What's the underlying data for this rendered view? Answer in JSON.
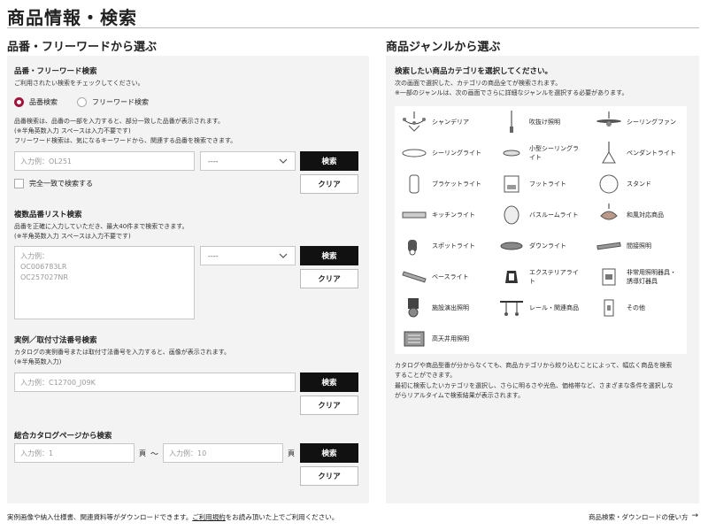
{
  "page": {
    "title": "商品情報・検索"
  },
  "left": {
    "heading": "品番・フリーワードから選ぶ",
    "keyword": {
      "heading": "品番・フリーワード検索",
      "instruction": "ご利用されたい検索をチェックしてください。",
      "radio_product": "品番検索",
      "radio_free": "フリーワード検索",
      "desc1": "品番検索は、品番の一部を入力すると、部分一致した品番が表示されます。",
      "desc2": "(※半角英数入力 スペースは入力不要です)",
      "desc3": "フリーワード検索は、気になるキーワードから、関連する品番を検索できます。",
      "placeholder": "入力例：OL251",
      "select": "----",
      "search": "検索",
      "clear": "クリア",
      "exact_label": "完全一致で検索する"
    },
    "multi": {
      "heading": "複数品番リスト検索",
      "desc1": "品番を正確に入力していただき、最大40件まで検索できます。",
      "desc2": "(※半角英数入力 スペースは入力不要です)",
      "placeholder": "入力例：\nOC006783LR\nOC257027NR",
      "select": "----",
      "search": "検索",
      "clear": "クリア"
    },
    "example": {
      "heading": "実例／取付寸法番号検索",
      "desc1": "カタログの実例番号または取付寸法番号を入力すると、画像が表示されます。",
      "desc2": "(※半角英数入力)",
      "placeholder": "入力例：C12700_J09K",
      "search": "検索",
      "clear": "クリア"
    },
    "catalog": {
      "heading": "総合カタログページから検索",
      "placeholder_from": "入力例：1",
      "page_unit_1": "頁",
      "tilde": "〜",
      "placeholder_to": "入力例：10",
      "page_unit_2": "頁",
      "search": "検索",
      "clear": "クリア"
    }
  },
  "right": {
    "heading": "商品ジャンルから選ぶ",
    "subheading": "検索したい商品カテゴリを選択してください。",
    "desc1": "次の画面で選択した、カテゴリの商品全てが検索されます。",
    "desc2": "※一部のジャンルは、次の画面でさらに詳細なジャンルを選択する必要があります。",
    "genres": [
      {
        "label": "シャンデリア",
        "icon": "chandelier-icon"
      },
      {
        "label": "吹抜け照明",
        "icon": "pendant-rod-icon"
      },
      {
        "label": "シーリングファン",
        "icon": "ceiling-fan-icon"
      },
      {
        "label": "シーリングライト",
        "icon": "ceiling-light-icon"
      },
      {
        "label": "小型シーリングラ\nイト",
        "icon": "small-ceiling-light-icon"
      },
      {
        "label": "ペンダントライト",
        "icon": "pendant-light-icon"
      },
      {
        "label": "ブラケットライト",
        "icon": "bracket-light-icon"
      },
      {
        "label": "フットライト",
        "icon": "foot-light-icon"
      },
      {
        "label": "スタンド",
        "icon": "stand-icon"
      },
      {
        "label": "キッチンライト",
        "icon": "kitchen-light-icon"
      },
      {
        "label": "バスルームライト",
        "icon": "bathroom-light-icon"
      },
      {
        "label": "和風対応商品",
        "icon": "japanese-lamp-icon"
      },
      {
        "label": "スポットライト",
        "icon": "spotlight-icon"
      },
      {
        "label": "ダウンライト",
        "icon": "downlight-icon"
      },
      {
        "label": "間接照明",
        "icon": "indirect-light-icon"
      },
      {
        "label": "ベースライト",
        "icon": "base-light-icon"
      },
      {
        "label": "エクステリアライ\nト",
        "icon": "exterior-light-icon"
      },
      {
        "label": "非常用照明器具・\n誘導灯器具",
        "icon": "emergency-light-icon"
      },
      {
        "label": "施設演出照明",
        "icon": "stage-light-icon"
      },
      {
        "label": "レール・関連商品",
        "icon": "rail-icon"
      },
      {
        "label": "その他",
        "icon": "other-icon"
      },
      {
        "label": "高天井用照明",
        "icon": "high-ceiling-light-icon"
      }
    ],
    "note1": "カタログや商品型番が分からなくても、商品カテゴリから絞り込むことによって、幅広く商品を検索",
    "note2": "することができます。",
    "note3": "最初に検索したいカテゴリを選択し、さらに明るさや光色、価格帯など、さまざまな条件を選択しな",
    "note4": "がらリアルタイムで検索結果が表示されます。"
  },
  "footer": {
    "left_text_1": "実例画像や納入仕様書、関連資料等がダウンロードできます。",
    "terms_link": "ご利用規約",
    "left_text_2": "をお読み頂いた上でご利用ください。",
    "right_link": "商品検索・ダウンロードの使い方",
    "right_arrow": "→"
  }
}
